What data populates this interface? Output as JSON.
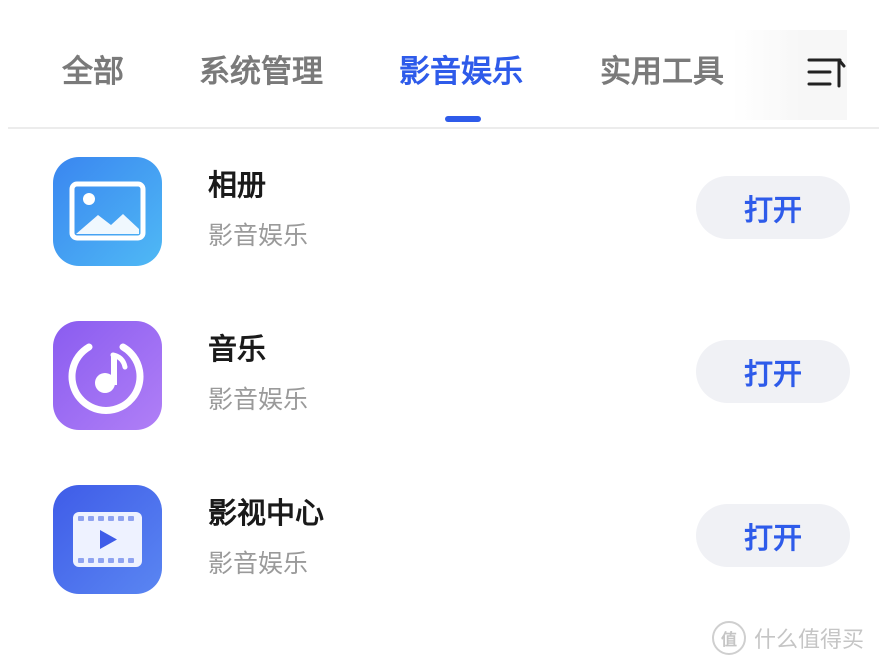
{
  "tabs": [
    {
      "label": "全部",
      "active": false
    },
    {
      "label": "系统管理",
      "active": false
    },
    {
      "label": "影音娱乐",
      "active": true
    },
    {
      "label": "实用工具",
      "active": false
    }
  ],
  "sort_icon": "sort-list-icon",
  "apps": [
    {
      "name": "相册",
      "category": "影音娱乐",
      "button": "打开",
      "icon": "gallery-icon"
    },
    {
      "name": "音乐",
      "category": "影音娱乐",
      "button": "打开",
      "icon": "music-icon"
    },
    {
      "name": "影视中心",
      "category": "影音娱乐",
      "button": "打开",
      "icon": "video-center-icon"
    }
  ],
  "watermark": {
    "icon_glyph": "值",
    "text": "什么值得买"
  },
  "colors": {
    "accent": "#2e5bea",
    "tab_inactive": "#7a7a7a",
    "button_bg": "#f0f1f5"
  }
}
